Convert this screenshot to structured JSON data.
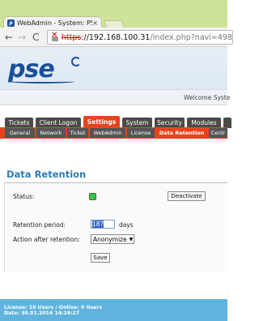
{
  "browser": {
    "tab_title": "WebAdmin - System: PSE",
    "tab_close": "×",
    "favicon": "p",
    "back": "←",
    "forward": "→",
    "reload": "C",
    "url_scheme": "https",
    "url_host": "://192.168.100.31",
    "url_path": "/index.php?navi=498"
  },
  "header": {
    "logo_text": "pse",
    "welcome": "Welcome Syste"
  },
  "main_tabs": [
    {
      "label": "Tickets"
    },
    {
      "label": "Client Logon"
    },
    {
      "label": "Settings",
      "active": true
    },
    {
      "label": "System"
    },
    {
      "label": "Security"
    },
    {
      "label": "Modules"
    }
  ],
  "sub_tabs": [
    {
      "label": "General"
    },
    {
      "label": "Network"
    },
    {
      "label": "Ticket"
    },
    {
      "label": "WebAdmin"
    },
    {
      "label": "License"
    },
    {
      "label": "Data Retention",
      "active": true
    },
    {
      "label": "Centr"
    }
  ],
  "content": {
    "title": "Data Retention",
    "status_label": "Status:",
    "status_color": "#3cc24a",
    "deactivate_label": "Deactivate",
    "retention_label": "Retention period:",
    "retention_value": "187",
    "retention_unit": "days",
    "action_label": "Action after retention:",
    "action_value": "Anonymize",
    "save_label": "Save"
  },
  "footer": {
    "license": "License: 10 Users  /  Online: 0 Users",
    "date": "Date: 30.01.2014 14:16:27"
  },
  "colors": {
    "accent": "#e8431f",
    "title_blue": "#2d7bb5",
    "footer": "#5fb3dc"
  }
}
